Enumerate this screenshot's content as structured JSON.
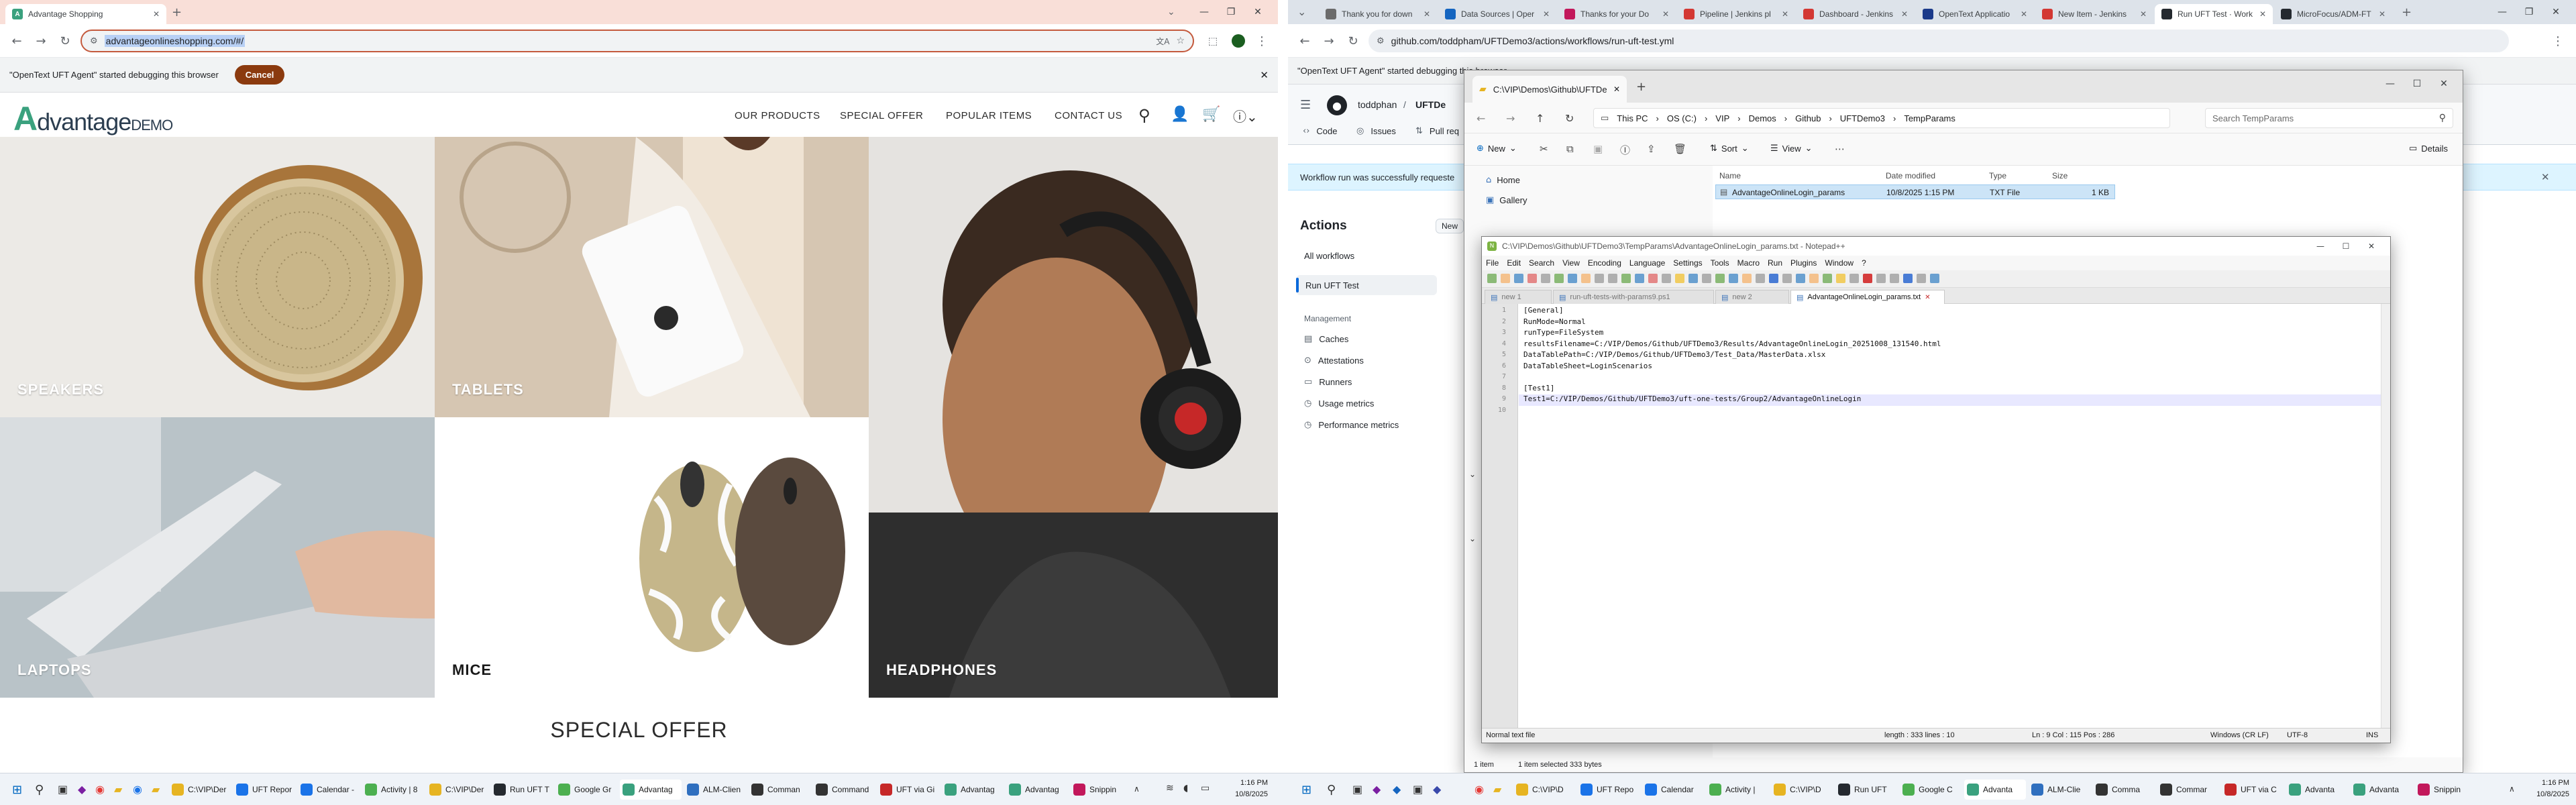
{
  "left_browser": {
    "tabs": [
      {
        "label": "Advantage Shopping",
        "active": true
      }
    ],
    "new_tab": "+",
    "address": "advantageonlineshopping.com/#/",
    "debug_message": "\"OpenText UFT Agent\" started debugging this browser",
    "cancel_label": "Cancel",
    "site": {
      "logo_a": "A",
      "logo_rest": "dvantage",
      "logo_demo": "DEMO",
      "nav": [
        "OUR PRODUCTS",
        "SPECIAL OFFER",
        "POPULAR ITEMS",
        "CONTACT US"
      ],
      "tiles": [
        "SPEAKERS",
        "TABLETS",
        "HEADPHONES",
        "LAPTOPS",
        "MICE"
      ],
      "special_offer": "SPECIAL OFFER"
    }
  },
  "right_browser": {
    "tabs": [
      {
        "label": "Thank you for down",
        "color": "#6b6b6b"
      },
      {
        "label": "Data Sources | Oper",
        "color": "#1565c0"
      },
      {
        "label": "Thanks for your Do",
        "color": "#c2185b"
      },
      {
        "label": "Pipeline | Jenkins pl",
        "color": "#d33833"
      },
      {
        "label": "Dashboard - Jenkins",
        "color": "#d33833"
      },
      {
        "label": "OpenText Applicatio",
        "color": "#1b3a8a"
      },
      {
        "label": "New Item - Jenkins",
        "color": "#d33833"
      },
      {
        "label": "Run UFT Test · Work",
        "color": "#24292f",
        "active": true
      },
      {
        "label": "MicroFocus/ADM-FT",
        "color": "#24292f"
      }
    ],
    "address": "github.com/toddpham/UFTDemo3/actions/workflows/run-uft-test.yml",
    "debug_message": "\"OpenText UFT Agent\" started debugging this browser",
    "github": {
      "repo_owner": "toddphan",
      "repo_name": "UFTDe",
      "tabs": [
        "Code",
        "Issues",
        "Pull req"
      ],
      "banner": "Workflow run was successfully requeste",
      "actions_title": "Actions",
      "new_btn": "New",
      "all_workflows": "All workflows",
      "run_uft": "Run UFT Test",
      "management": "Management",
      "mgmt_items": [
        "Caches",
        "Attestations",
        "Runners",
        "Usage metrics",
        "Performance metrics"
      ]
    }
  },
  "explorer": {
    "tab_title": "C:\\VIP\\Demos\\Github\\UFTDer",
    "breadcrumb": [
      "This PC",
      "OS (C:)",
      "VIP",
      "Demos",
      "Github",
      "UFTDemo3",
      "TempParams"
    ],
    "search_placeholder": "Search TempParams",
    "cmd": {
      "new": "New",
      "sort": "Sort",
      "view": "View",
      "details": "Details"
    },
    "nav": [
      "Home",
      "Gallery"
    ],
    "columns": [
      "Name",
      "Date modified",
      "Type",
      "Size"
    ],
    "file": {
      "name": "AdvantageOnlineLogin_params",
      "date": "10/8/2025 1:15 PM",
      "type": "TXT File",
      "size": "1 KB"
    },
    "status_items": "1 item",
    "status_selected": "1 item selected  333 bytes"
  },
  "notepad": {
    "title": "C:\\VIP\\Demos\\Github\\UFTDemo3\\TempParams\\AdvantageOnlineLogin_params.txt - Notepad++",
    "menu": [
      "File",
      "Edit",
      "Search",
      "View",
      "Encoding",
      "Language",
      "Settings",
      "Tools",
      "Macro",
      "Run",
      "Plugins",
      "Window",
      "?"
    ],
    "doc_tabs": [
      "new 1",
      "run-uft-tests-with-params9.ps1",
      "new 2",
      "AdvantageOnlineLogin_params.txt"
    ],
    "lines": [
      "[General]",
      "RunMode=Normal",
      "runType=FileSystem",
      "resultsFilename=C:/VIP/Demos/Github/UFTDemo3/Results/AdvantageOnlineLogin_20251008_131540.html",
      "DataTablePath=C:/VIP/Demos/Github/UFTDemo3/Test_Data/MasterData.xlsx",
      "DataTableSheet=LoginScenarios",
      "",
      "[Test1]",
      "Test1=C:/VIP/Demos/Github/UFTDemo3/uft-one-tests/Group2/AdvantageOnlineLogin",
      ""
    ],
    "line_numbers": [
      "1",
      "2",
      "3",
      "4",
      "5",
      "6",
      "7",
      "8",
      "9",
      "10"
    ],
    "status": {
      "type": "Normal text file",
      "length": "length : 333    lines : 10",
      "pos": "Ln : 9    Col : 115    Pos : 286",
      "eol": "Windows (CR LF)",
      "enc": "UTF-8",
      "ins": "INS"
    }
  },
  "taskbar": {
    "left_items": [
      {
        "label": "C:\\VIP\\Der",
        "color": "#e6b422"
      },
      {
        "label": "UFT Repor",
        "color": "#1a73e8"
      },
      {
        "label": "Calendar -",
        "color": "#1a73e8"
      },
      {
        "label": "Activity | 8",
        "color": "#4caf50"
      },
      {
        "label": "C:\\VIP\\Der",
        "color": "#e6b422"
      },
      {
        "label": "Run UFT T",
        "color": "#24292f"
      },
      {
        "label": "Google Gr",
        "color": "#4caf50"
      },
      {
        "label": "Advantag",
        "color": "#3aa17e",
        "active": true
      },
      {
        "label": "ALM-Clien",
        "color": "#2f6fbf"
      },
      {
        "label": "Comman",
        "color": "#333333"
      },
      {
        "label": "Command",
        "color": "#333333"
      },
      {
        "label": "UFT via Gi",
        "color": "#c62828"
      },
      {
        "label": "Advantag",
        "color": "#3aa17e"
      },
      {
        "label": "Advantag",
        "color": "#3aa17e"
      },
      {
        "label": "Snippin",
        "color": "#c2185b"
      }
    ],
    "left_time": "1:16 PM",
    "left_date": "10/8/2025",
    "right_items": [
      {
        "label": "C:\\VIP\\D",
        "color": "#e6b422"
      },
      {
        "label": "UFT Repo",
        "color": "#1a73e8"
      },
      {
        "label": "Calendar",
        "color": "#1a73e8"
      },
      {
        "label": "Activity |",
        "color": "#4caf50"
      },
      {
        "label": "C:\\VIP\\D",
        "color": "#e6b422"
      },
      {
        "label": "Run UFT",
        "color": "#24292f"
      },
      {
        "label": "Google C",
        "color": "#4caf50"
      },
      {
        "label": "Advanta",
        "color": "#3aa17e",
        "active": true
      },
      {
        "label": "ALM-Clie",
        "color": "#2f6fbf"
      },
      {
        "label": "Comma",
        "color": "#333333"
      },
      {
        "label": "Commar",
        "color": "#333333"
      },
      {
        "label": "UFT via C",
        "color": "#c62828"
      },
      {
        "label": "Advanta",
        "color": "#3aa17e"
      },
      {
        "label": "Advanta",
        "color": "#3aa17e"
      },
      {
        "label": "Snippin",
        "color": "#c2185b"
      }
    ],
    "right_time": "1:16 PM",
    "right_date": "10/8/2025"
  }
}
